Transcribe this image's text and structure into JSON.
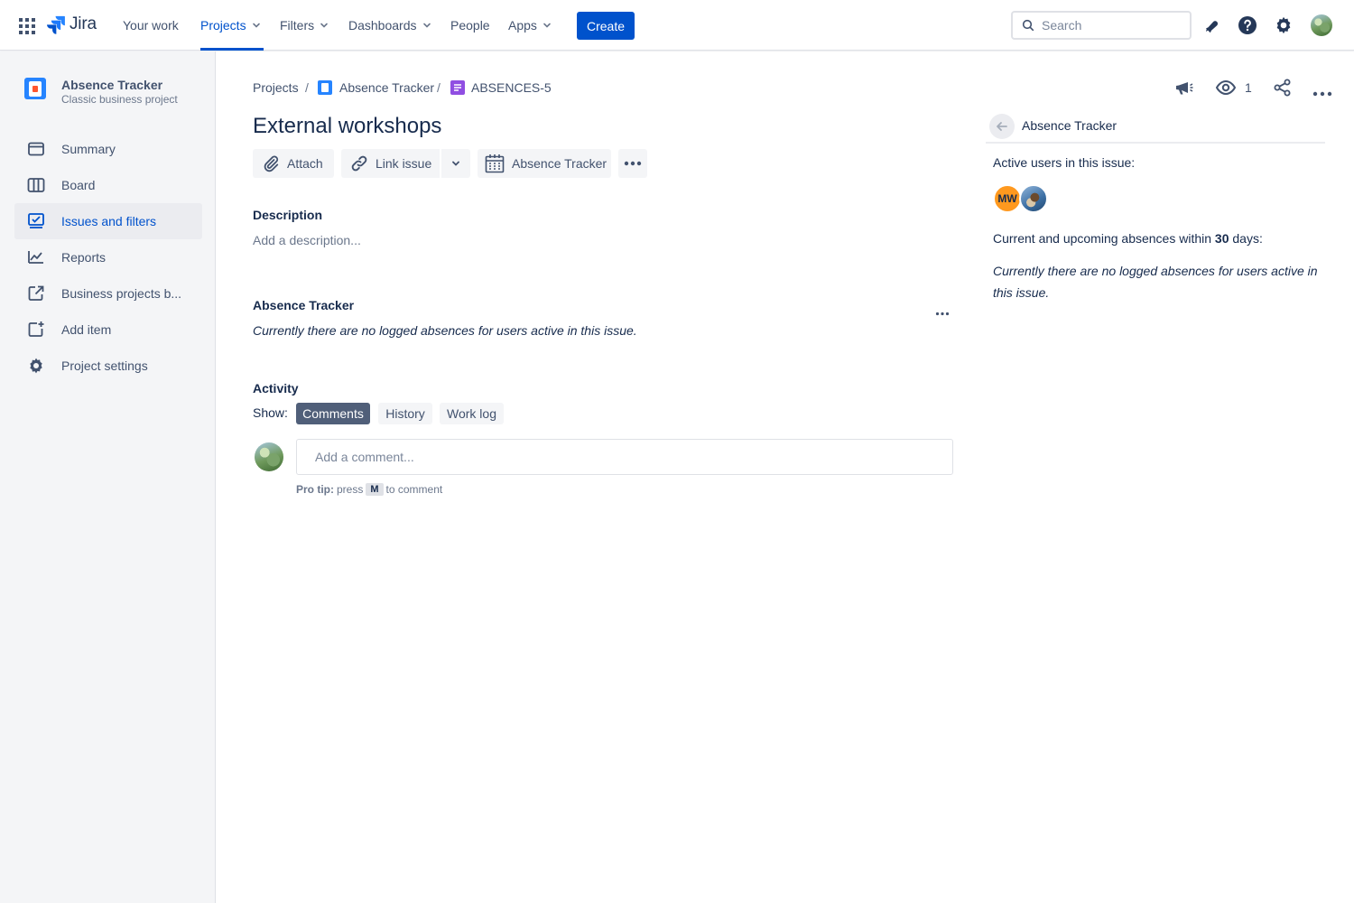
{
  "topnav": {
    "logo": "Jira",
    "items": [
      {
        "label": "Your work",
        "dropdown": false
      },
      {
        "label": "Projects",
        "dropdown": true,
        "active": true
      },
      {
        "label": "Filters",
        "dropdown": true
      },
      {
        "label": "Dashboards",
        "dropdown": true
      },
      {
        "label": "People",
        "dropdown": false
      },
      {
        "label": "Apps",
        "dropdown": true
      }
    ],
    "create_label": "Create",
    "search_placeholder": "Search",
    "icons": [
      "app-switcher-icon",
      "notifications-icon",
      "help-icon",
      "settings-icon",
      "profile-avatar"
    ]
  },
  "sidebar": {
    "project_name": "Absence Tracker",
    "project_type": "Classic business project",
    "items": [
      {
        "label": "Summary",
        "icon": "summary-icon"
      },
      {
        "label": "Board",
        "icon": "board-icon"
      },
      {
        "label": "Issues and filters",
        "icon": "issues-icon",
        "active": true
      },
      {
        "label": "Reports",
        "icon": "reports-icon"
      },
      {
        "label": "Business projects b...",
        "icon": "external-link-icon"
      },
      {
        "label": "Add item",
        "icon": "add-item-icon"
      },
      {
        "label": "Project settings",
        "icon": "gear-icon"
      }
    ]
  },
  "breadcrumb": {
    "items": [
      "Projects",
      "Absence Tracker",
      "ABSENCES-5"
    ],
    "separator": "/"
  },
  "header_actions": {
    "watchers_count": "1"
  },
  "issue": {
    "title": "External workshops",
    "toolbar": {
      "attach": "Attach",
      "link_issue": "Link issue",
      "absence_tracker": "Absence Tracker"
    },
    "description": {
      "heading": "Description",
      "placeholder": "Add a description..."
    },
    "absence_section": {
      "heading": "Absence Tracker",
      "message": "Currently there are no logged absences for users active in this issue."
    },
    "activity": {
      "heading": "Activity",
      "show_label": "Show:",
      "filters": [
        {
          "label": "Comments",
          "active": true
        },
        {
          "label": "History",
          "active": false
        },
        {
          "label": "Work log",
          "active": false
        }
      ],
      "comment_placeholder": "Add a comment...",
      "pro_tip_label": "Pro tip:",
      "pro_tip_press": "press",
      "pro_tip_key": "M",
      "pro_tip_suffix": "to comment"
    }
  },
  "right_panel": {
    "title": "Absence Tracker",
    "active_users_label": "Active users in this issue:",
    "avatars": [
      {
        "initials": "MW",
        "color": "#ff991f"
      }
    ],
    "upcoming_prefix": "Current and upcoming absences within",
    "upcoming_days": "30",
    "upcoming_suffix": "days:",
    "empty_line1": "Currently there are no logged absences for users active in",
    "empty_line2": "this issue."
  },
  "colors": {
    "brand": "#0052cc",
    "sidebar_bg": "#f4f5f7",
    "active_pill": "#505f79",
    "text": "#172b4d",
    "muted": "#6b778c"
  }
}
